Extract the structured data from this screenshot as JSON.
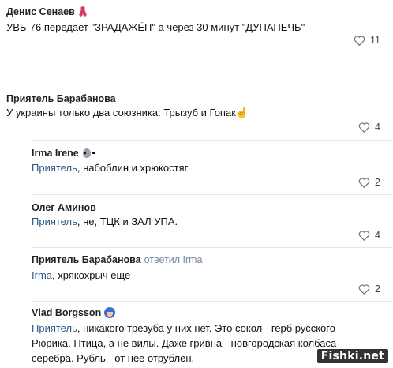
{
  "comments": [
    {
      "author": "Денис Сенаев",
      "author_icon": "ribbon-icon",
      "lines": [
        "УВБ-76 передает \"ЗРАДАЖЁП\" а через 30 минут \"ДУПАПЕЧЬ\""
      ],
      "likes": "11"
    },
    {
      "author": "Приятель Барабанова",
      "lines": [
        "У украины только два союзника: Трызуб и Гопак"
      ],
      "emoji": "☝",
      "likes": "4"
    }
  ],
  "replies": [
    {
      "author": "Irma Irene",
      "author_icon": "alien-icon",
      "mention": "Приятель",
      "text": ", набоблин и хрюкостяг",
      "likes": "2"
    },
    {
      "author": "Олег Аминов",
      "mention": "Приятель",
      "text": ", не, ТЦК и ЗАЛ УПА.",
      "likes": "4"
    },
    {
      "author": "Приятель Барабанова",
      "replied_to": "ответил Irma",
      "mention": "Irma",
      "text": ", хрякохрыч еще",
      "likes": "2"
    },
    {
      "author": "Vlad Borgsson",
      "author_icon": "helmet-icon",
      "mention": "Приятель",
      "text": ", никакого трезуба у них нет. Это сокол - герб русского",
      "lines": [
        "Рюрика. Птица, а не вилы. Даже гривна - новгородская колбаса",
        "серебра. Рубль - от нее отрублен."
      ]
    }
  ],
  "watermark": "Fishki.net",
  "colors": {
    "link": "#2a5885",
    "divider": "#e4e6ea",
    "muted": "#7b8a9c"
  }
}
